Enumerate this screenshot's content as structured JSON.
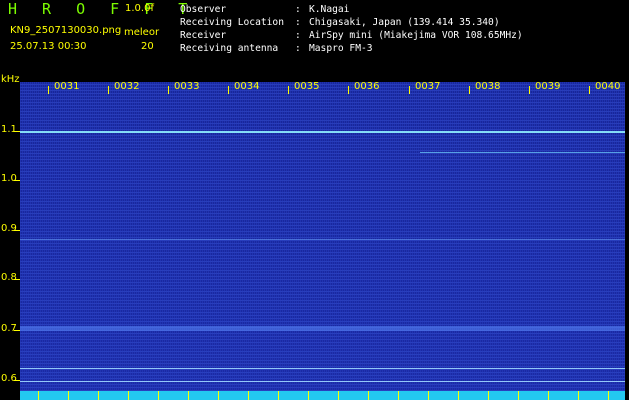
{
  "header": {
    "title": "H R O F F T",
    "version": "1.0.0f",
    "filename": "KN9_2507130030.png",
    "datetime": "25.07.13 00:30",
    "meteor_label": "meleor",
    "meteor_count": "20",
    "meta": [
      {
        "key": "Observer",
        "sep": ":",
        "value": "K.Nagai"
      },
      {
        "key": "Receiving Location",
        "sep": ":",
        "value": "Chigasaki, Japan (139.414 35.340)"
      },
      {
        "key": "Receiver",
        "sep": ":",
        "value": "AirSpy mini (Miakejima VOR 108.65MHz)"
      },
      {
        "key": "Receiving antenna",
        "sep": ":",
        "value": "Maspro FM-3"
      }
    ]
  },
  "spectrogram": {
    "unit": "kHz",
    "y_labels": [
      "1.1",
      "1.0",
      "0.9",
      "0.8",
      "0.7",
      "0.6"
    ],
    "minute_labels": [
      "0031",
      "0032",
      "0033",
      "0034",
      "0035",
      "0036",
      "0037",
      "0038",
      "0039",
      "0040"
    ],
    "colors": {
      "background": "#1a2aa6",
      "bottom_band": "#23c8f0",
      "axis_text": "#ffff00",
      "carrier": "#8ff0ff"
    }
  }
}
